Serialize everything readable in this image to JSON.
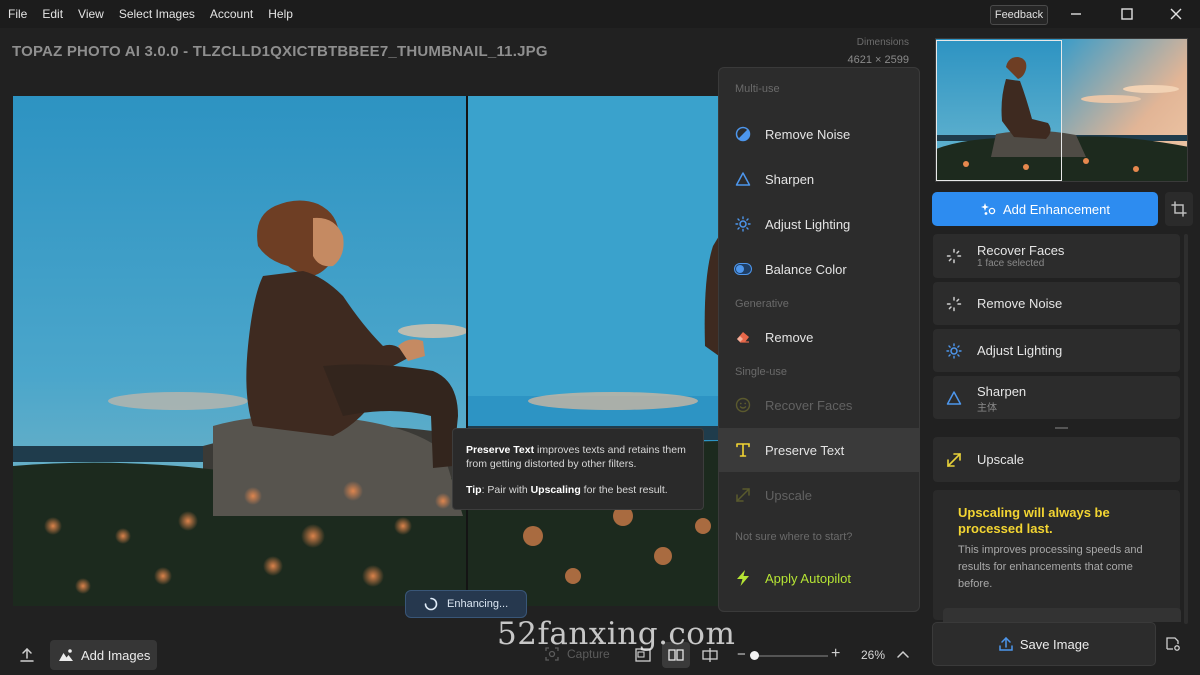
{
  "menubar": {
    "items": [
      "File",
      "Edit",
      "View",
      "Select Images",
      "Account",
      "Help"
    ],
    "feedback_label": "Feedback"
  },
  "document": {
    "title": "TOPAZ PHOTO AI 3.0.0 - TLZCLLD1QXICTBTBBEE7_THUMBNAIL_11.JPG",
    "dimensions_label": "Dimensions",
    "dimensions_value": "4621 × 2599"
  },
  "filter_menu": {
    "sections": {
      "multi_use": "Multi-use",
      "generative": "Generative",
      "single_use": "Single-use",
      "help": "Not sure where to start?"
    },
    "items": {
      "remove_noise": "Remove Noise",
      "sharpen": "Sharpen",
      "adjust_lighting": "Adjust Lighting",
      "balance_color": "Balance Color",
      "remove": "Remove",
      "recover_faces": "Recover Faces",
      "preserve_text": "Preserve Text",
      "upscale": "Upscale",
      "apply_autopilot": "Apply Autopilot"
    }
  },
  "tooltip": {
    "line1_bold": "Preserve Text",
    "line1_rest": " improves texts and retains them from getting distorted by other filters.",
    "tip_bold": "Tip",
    "tip_mid": ": Pair with ",
    "tip_bold2": "Upscaling",
    "tip_rest": " for the best result."
  },
  "status": {
    "enhancing": "Enhancing..."
  },
  "bottombar": {
    "add_images": "Add Images",
    "capture": "Capture",
    "zoom_value": "26%",
    "zoom_level": 0.02
  },
  "right_panel": {
    "add_enhancement": "Add Enhancement",
    "enhancements": {
      "recover_faces": {
        "name": "Recover Faces",
        "sub": "1 face selected"
      },
      "remove_noise": {
        "name": "Remove Noise"
      },
      "adjust_lighting": {
        "name": "Adjust Lighting"
      },
      "sharpen": {
        "name": "Sharpen",
        "sub": "主体"
      },
      "upscale": {
        "name": "Upscale"
      }
    },
    "note": {
      "title": "Upscaling will always be processed last.",
      "body": "This improves processing speeds and results for enhancements that come before."
    },
    "save_image": "Save Image"
  },
  "watermark": "52fanxing.com",
  "colors": {
    "accent_blue": "#2d8cf0",
    "autopilot_green": "#b6e534",
    "note_yellow": "#f3d532",
    "upscale_yellow": "#e8d23a"
  },
  "icons": {
    "remove_noise": "half-circle-icon",
    "sharpen": "triangle-icon",
    "adjust_lighting": "sun-icon",
    "balance_color": "toggle-icon",
    "remove": "eraser-icon",
    "recover_faces": "smiley-icon",
    "preserve_text": "text-t-icon",
    "upscale": "diagonal-arrow-icon",
    "apply_autopilot": "lightning-icon"
  }
}
